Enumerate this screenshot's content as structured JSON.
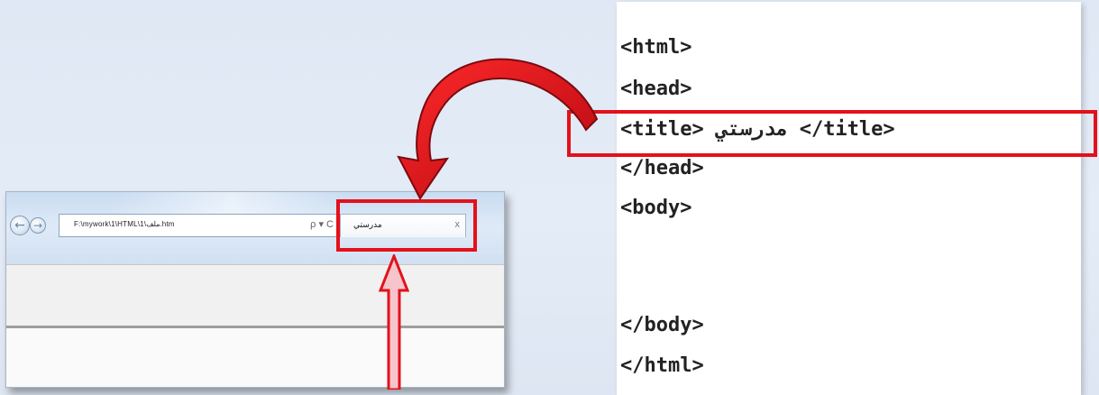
{
  "browser": {
    "back_icon": "←",
    "forward_icon": "→",
    "address": "F:\\mywork\\1\\HTML\\1\\ملف.htm",
    "address_tools": "ρ ▾ C",
    "tab_title": "مدرستي",
    "tab_close": "x"
  },
  "code": {
    "lines": [
      "<html>",
      "<head>",
      "<title> مدرستي </title>",
      "</head>",
      "<body>",
      "</body>",
      "</html>"
    ]
  },
  "colors": {
    "highlight": "#e3111b",
    "arrow_fill": "#d40f17",
    "up_arrow_fill": "#f6c4cb",
    "up_arrow_stroke": "#e3111b"
  },
  "icons": [
    "back-arrow-icon",
    "forward-arrow-icon",
    "search-icon",
    "refresh-icon",
    "close-icon",
    "curved-arrow-icon",
    "up-arrow-icon"
  ]
}
